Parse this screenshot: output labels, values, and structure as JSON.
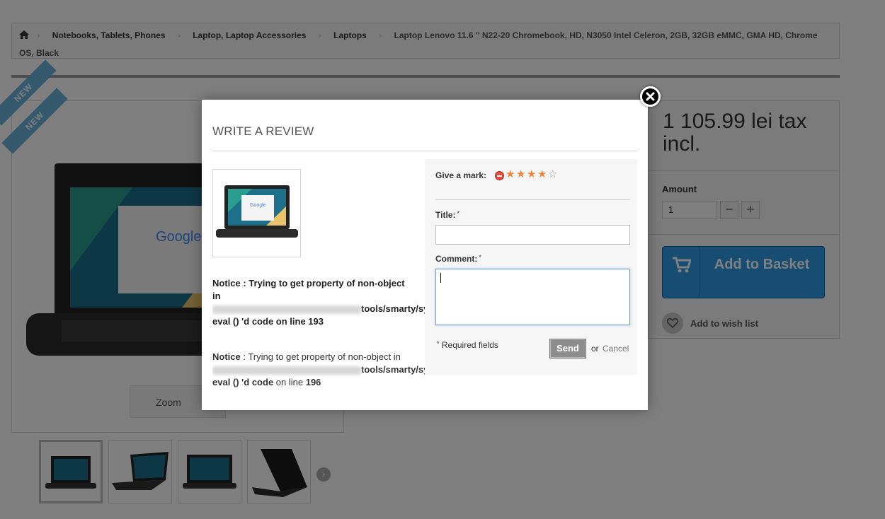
{
  "breadcrumb": {
    "items": [
      "Notebooks, Tablets, Phones",
      "Laptop, Laptop Accessories",
      "Laptops"
    ],
    "current": "Laptop Lenovo 11.6 '' N22-20 Chromebook, HD, N3050 Intel Celeron, 2GB, 32GB eMMC, GMA HD, Chrome OS, Black"
  },
  "product": {
    "badges": [
      "NEW",
      "NEW"
    ],
    "zoom_label": "Zoom",
    "price": "1 105.99 lei tax incl.",
    "amount_label": "Amount",
    "amount_value": "1",
    "minus_label": "−",
    "plus_label": "+",
    "add_to_basket": "Add to Basket",
    "wishlist": "Add to wish list"
  },
  "review_modal": {
    "title": "WRITE A REVIEW",
    "notice1": {
      "label": "Notice : Trying to get property of non-object",
      "in": "in",
      "path_tail": "tools/smarty/sy",
      "code_line": "eval () 'd code on line 193"
    },
    "notice2": {
      "label": "Notice",
      "message": " : Trying to get property of non-object in",
      "path_tail": "tools/smarty/sy",
      "code_prefix": "eval () 'd code",
      "on_line": " on line ",
      "line_number": "196"
    },
    "give_mark_label": "Give a mark:",
    "rating": 4,
    "rating_max": 5,
    "title_label": "Title:",
    "title_value": "",
    "comment_label": "Comment:",
    "comment_value": "",
    "required_mark": "*",
    "required_note": "Required fields",
    "send_label": "Send",
    "or_label": "or",
    "cancel_label": "Cancel"
  },
  "colors": {
    "accent_blue": "#2f9be5",
    "star_on": "#f0843a",
    "ribbon": "#6ab2d9"
  }
}
